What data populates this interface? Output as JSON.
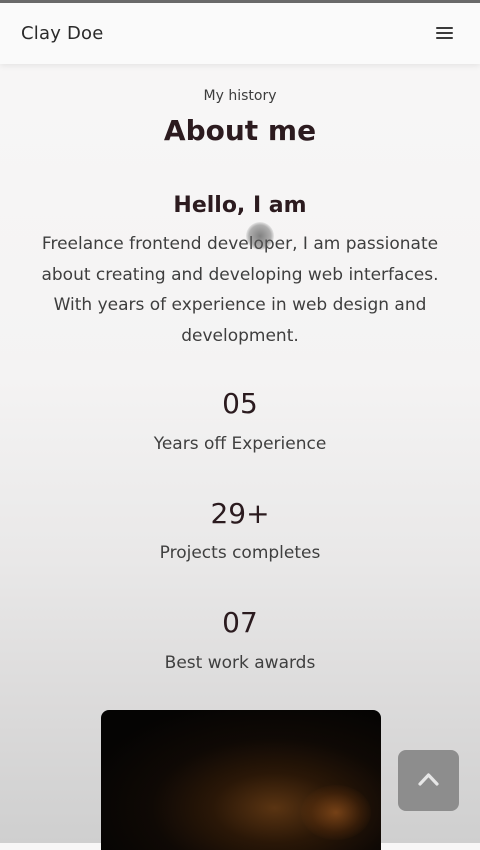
{
  "header": {
    "logo": "Clay Doe",
    "menu_icon": "hamburger-menu-icon"
  },
  "about": {
    "subtitle": "My history",
    "title": "About me",
    "greeting": "Hello, I am",
    "description": "Freelance frontend developer, I am passionate about creating and developing web interfaces. With years of experience in web design and development."
  },
  "stats": [
    {
      "number": "05",
      "label": "Years off Experience"
    },
    {
      "number": "29+",
      "label": "Projects completes"
    },
    {
      "number": "07",
      "label": "Best work awards"
    }
  ],
  "scroll_top_icon": "chevron-up-icon",
  "colors": {
    "title": "#2c1b1f",
    "header_bg": "#fafafa",
    "scroll_button": "#8d8d8d"
  }
}
